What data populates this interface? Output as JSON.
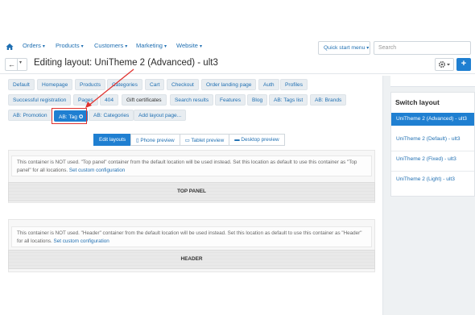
{
  "nav": {
    "items": [
      {
        "label": "Orders"
      },
      {
        "label": "Products"
      },
      {
        "label": "Customers"
      },
      {
        "label": "Marketing"
      },
      {
        "label": "Website"
      }
    ],
    "quick_start": "Quick start menu",
    "search_placeholder": "Search"
  },
  "header": {
    "title": "Editing layout: UniTheme 2 (Advanced) - ult3"
  },
  "locations": {
    "row1": [
      "Default",
      "Homepage",
      "Products",
      "Categories",
      "Cart",
      "Checkout",
      "Order landing page",
      "Auth",
      "Profiles"
    ],
    "row2": [
      "Successful registration",
      "Pages",
      "404",
      "Gift certificates",
      "Search results",
      "Features",
      "Blog",
      "AB: Tags list",
      "AB: Brands"
    ],
    "row3": [
      "AB: Promotion",
      "AB: Tag",
      "AB: Categories",
      "Add layout page..."
    ]
  },
  "modes": [
    "Edit layouts",
    "Phone preview",
    "Tablet preview",
    "Desktop preview"
  ],
  "containers": [
    {
      "notice": "This container is NOT used. \"Top panel\" container from the default location will be used instead. Set this location as default to use this container as \"Top panel\" for all locations.",
      "link": "Set custom configuration",
      "label": "TOP PANEL"
    },
    {
      "notice": "This container is NOT used. \"Header\" container from the default location will be used instead. Set this location as default to use this container as \"Header\" for all locations.",
      "link": "Set custom configuration",
      "label": "HEADER"
    }
  ],
  "sidebar": {
    "title": "Switch layout",
    "layouts": [
      "UniTheme 2 (Advanced) - ult3",
      "UniTheme 2 (Default) - ult3",
      "UniTheme 2 (Fixed) - ult3",
      "UniTheme 2 (Light) - ult3"
    ]
  },
  "colors": {
    "accent": "#1f7fd1",
    "link": "#1f6fb2",
    "annotation": "#e0322f"
  }
}
